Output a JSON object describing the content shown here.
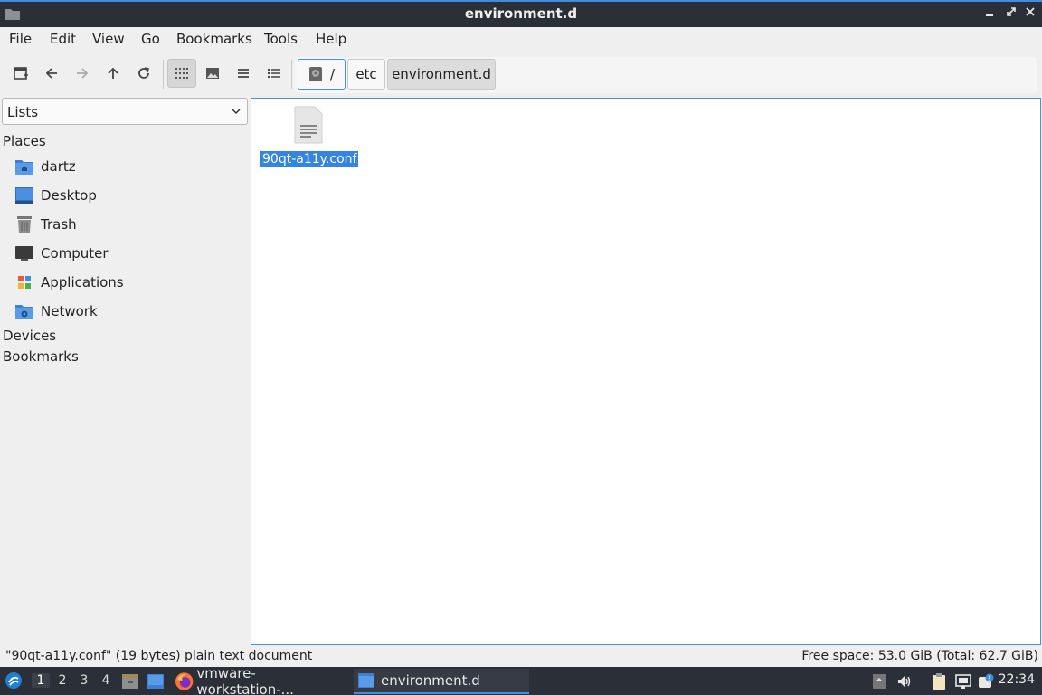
{
  "window": {
    "title": "environment.d"
  },
  "menu": [
    "File",
    "Edit",
    "View",
    "Go",
    "Bookmarks",
    "Tools",
    "Help"
  ],
  "breadcrumb": {
    "root": "/",
    "items": [
      "etc",
      "environment.d"
    ]
  },
  "sidebar": {
    "combo_value": "Lists",
    "sections": {
      "places": "Places",
      "devices": "Devices",
      "bookmarks": "Bookmarks"
    },
    "places": [
      {
        "label": "dartz",
        "icon": "home-folder-icon"
      },
      {
        "label": "Desktop",
        "icon": "desktop-icon"
      },
      {
        "label": "Trash",
        "icon": "trash-icon"
      },
      {
        "label": "Computer",
        "icon": "computer-icon"
      },
      {
        "label": "Applications",
        "icon": "applications-icon"
      },
      {
        "label": "Network",
        "icon": "network-icon"
      }
    ]
  },
  "files": [
    {
      "name": "90qt-a11y.conf",
      "icon": "text-file-icon",
      "selected": true
    }
  ],
  "status": {
    "left": "\"90qt-a11y.conf\" (19 bytes) plain text document",
    "right": "Free space: 53.0 GiB (Total: 62.7 GiB)"
  },
  "taskbar": {
    "workspaces": [
      "1",
      "2",
      "3",
      "4"
    ],
    "tasks": [
      {
        "label": "vmware-workstation-...",
        "icon": "firefox-icon"
      },
      {
        "label": "environment.d",
        "icon": "folder-icon"
      }
    ],
    "clock": "22:34"
  },
  "colors": {
    "accent": "#3584e4",
    "titlebar": "#2b2f37"
  }
}
